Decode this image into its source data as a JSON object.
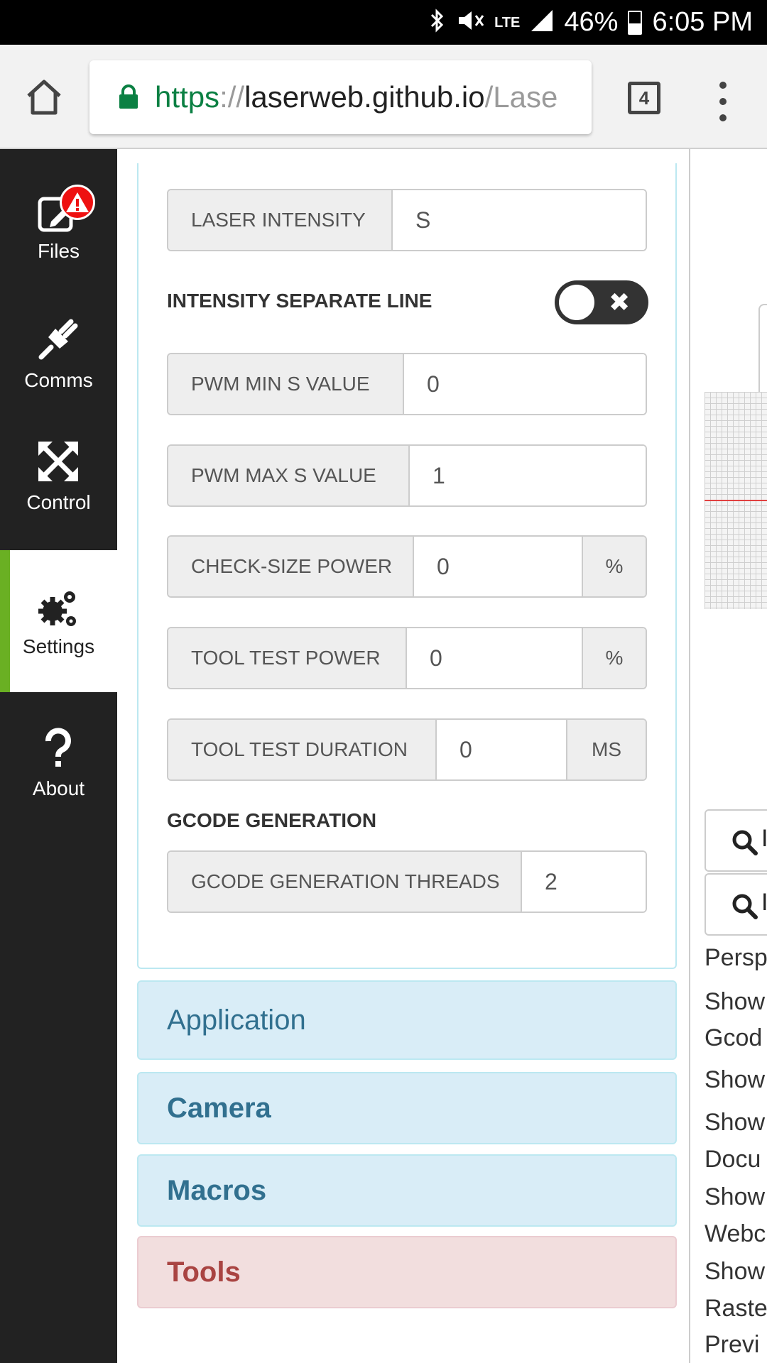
{
  "status_bar": {
    "battery": "46%",
    "time": "6:05 PM",
    "network": "LTE",
    "battery_level": 0.46
  },
  "browser": {
    "url_scheme": "https",
    "url_sep": "://",
    "url_host": "laserweb.github.io",
    "url_path": "/Lase",
    "tab_count": "4"
  },
  "sidebar": {
    "items": [
      {
        "label": "Files",
        "icon": "files-icon",
        "badge": "warning"
      },
      {
        "label": "Comms",
        "icon": "plug-icon"
      },
      {
        "label": "Control",
        "icon": "move-arrows-icon"
      },
      {
        "label": "Settings",
        "icon": "gears-icon",
        "active": true
      },
      {
        "label": "About",
        "icon": "question-icon"
      }
    ]
  },
  "settings": {
    "laser_intensity": {
      "label": "LASER INTENSITY",
      "value": "S"
    },
    "intensity_separate_line": {
      "label": "INTENSITY SEPARATE LINE",
      "enabled": false,
      "toggle_glyph": "✖"
    },
    "pwm_min": {
      "label": "PWM MIN S VALUE",
      "value": "0"
    },
    "pwm_max": {
      "label": "PWM MAX S VALUE",
      "value": "1"
    },
    "check_size_power": {
      "label": "CHECK-SIZE POWER",
      "value": "0",
      "unit": "%"
    },
    "tool_test_power": {
      "label": "TOOL TEST POWER",
      "value": "0",
      "unit": "%"
    },
    "tool_test_duration": {
      "label": "TOOL TEST DURATION",
      "value": "0",
      "unit": "MS"
    },
    "gcode_generation_heading": "GCODE GENERATION",
    "gcode_threads": {
      "label": "GCODE GENERATION THREADS",
      "value": "2"
    }
  },
  "sections": {
    "application": "Application",
    "camera": "Camera",
    "macros": "Macros",
    "tools": "Tools"
  },
  "right_pane": {
    "zoom_1_glyph": "I",
    "zoom_2_glyph": "I",
    "labels": [
      "Persp",
      "Show",
      "Gcod",
      "Show",
      "Show",
      "Docu",
      "Show",
      "Webc",
      "Show",
      "Raste",
      "Previ"
    ]
  },
  "colors": {
    "sidebar_bg": "#222222",
    "active_accent": "#6ab023",
    "info_bg": "#d9edf7",
    "info_text": "#31708f",
    "danger_bg": "#f2dede",
    "danger_text": "#a94442",
    "secure_green": "#0b8043"
  }
}
